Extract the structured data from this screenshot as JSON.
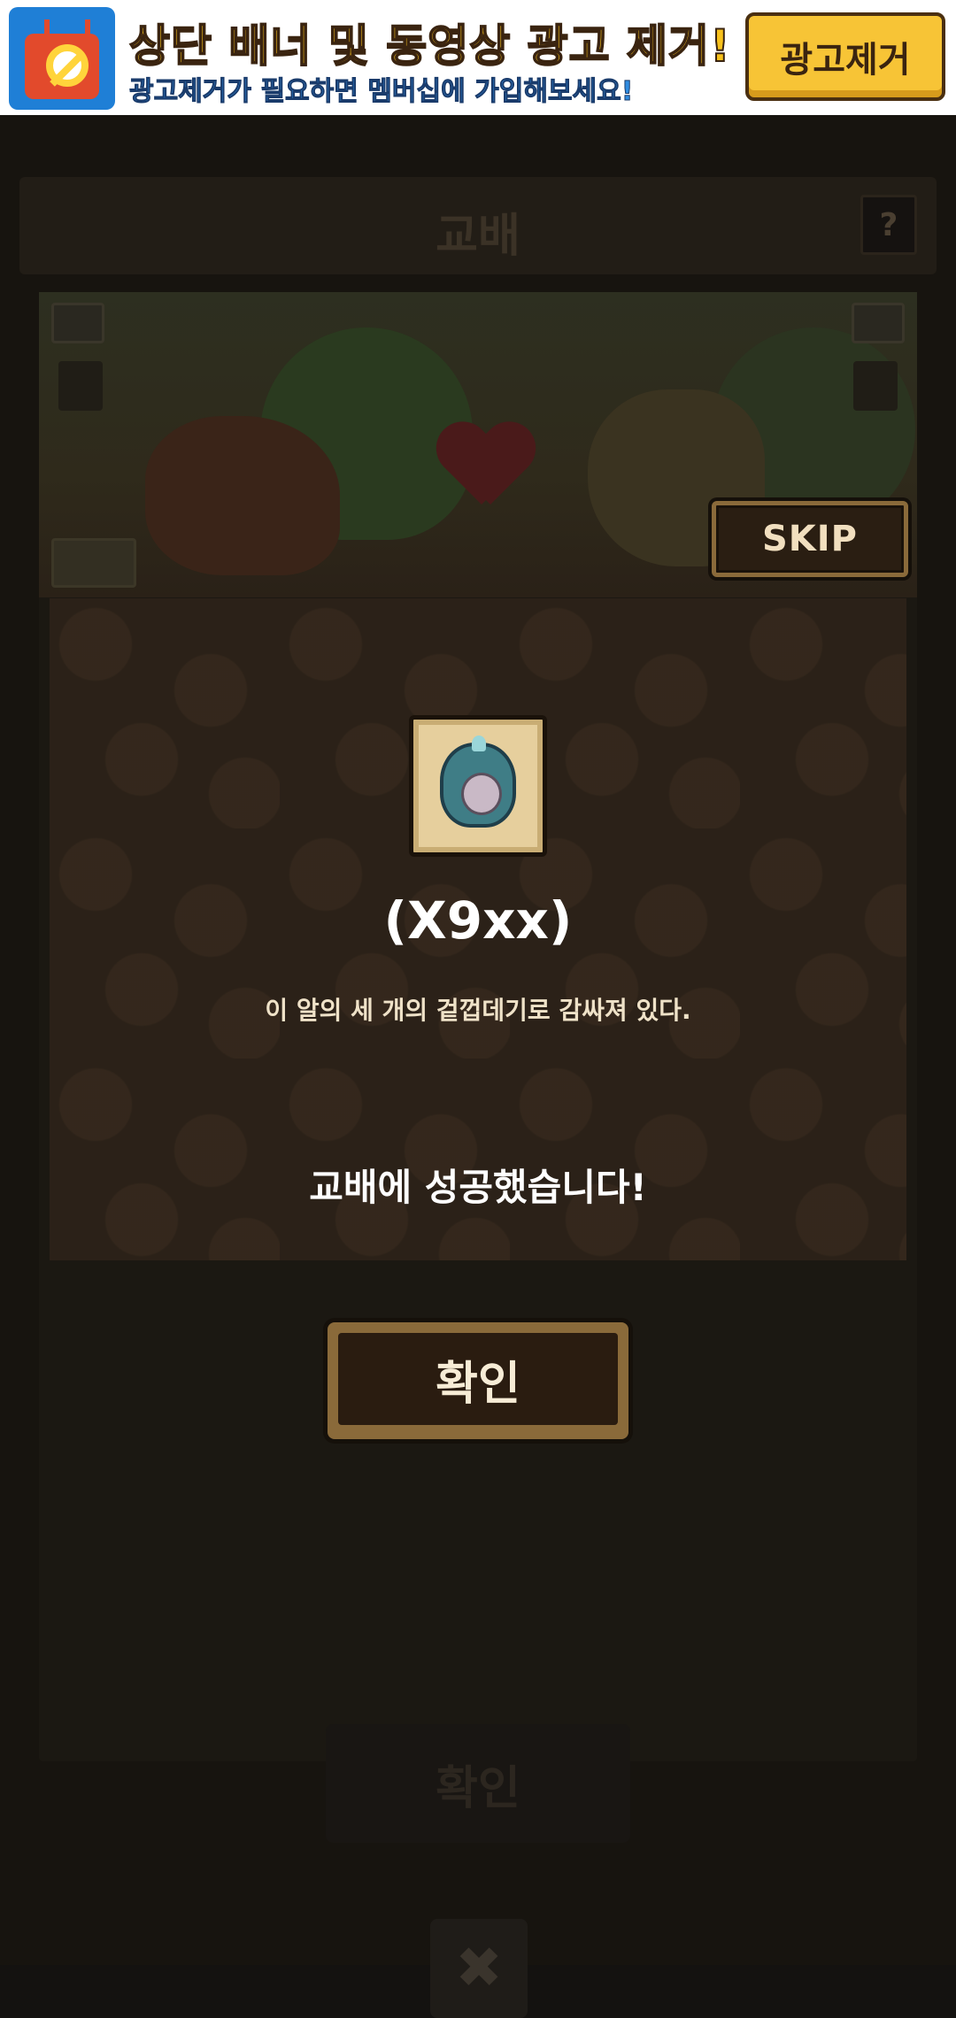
{
  "ad_banner": {
    "title": "상단 배너 및 동영상 광고 제거!",
    "subtitle": "광고제거가 필요하면 멤버십에 가입해보세요!",
    "remove_button": "광고제거",
    "colors": {
      "title": "#f8c21c",
      "subtitle": "#2f8ce0",
      "button": "#f7c436"
    }
  },
  "header": {
    "title": "교배",
    "help_label": "?"
  },
  "scene": {
    "skip_label": "SKIP"
  },
  "result": {
    "item_icon": "egg-icon",
    "item_name": "(X9xx)",
    "item_description": "이 알의 세 개의 겉껍데기로 감싸져 있다.",
    "message": "교배에 성공했습니다!",
    "confirm_label": "확인"
  },
  "background": {
    "confirm_label": "확인",
    "close_label": "✖"
  }
}
